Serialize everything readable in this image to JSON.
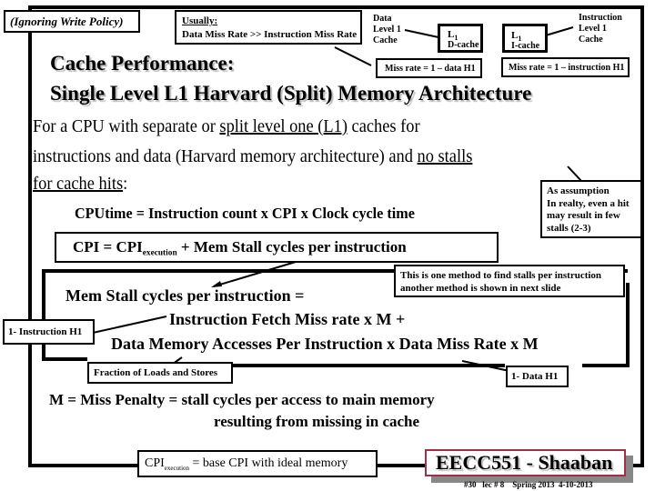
{
  "callouts": {
    "ignoring_write_policy": "(Ignoring Write Policy)",
    "usually_label": "Usually:",
    "usually_text": "Data Miss Rate >> Instruction Miss Rate",
    "data_l1_label": [
      "Data",
      "Level 1",
      "Cache"
    ],
    "d_cache_l": "L",
    "d_cache_sub": "1",
    "d_cache_name": "D-cache",
    "i_cache_l": "L",
    "i_cache_sub": "1",
    "i_cache_name": "I-cache",
    "instruction_l1_label": [
      "Instruction",
      "Level 1",
      "Cache"
    ],
    "data_miss_rate": "Miss rate = 1 – data H1",
    "instruction_miss_rate": "Miss rate = 1 – instruction H1",
    "assumption": [
      "As assumption",
      "In realty, even a hit",
      "may result in few",
      "stalls (2-3)"
    ],
    "method_note": [
      "This is one method to find stalls per instruction",
      "another method is shown in next slide"
    ],
    "instruction_h1": "1- Instruction H1",
    "fraction_loads_stores": "Fraction of Loads and Stores",
    "data_h1": "1- Data H1",
    "cpi_execution_main": "CPI",
    "cpi_execution_sub": "execution",
    "cpi_execution_def": "= base CPI with ideal memory"
  },
  "title": {
    "line1": "Cache Performance:",
    "line2": "Single Level L1 Harvard  (Split) Memory Architecture"
  },
  "body": {
    "p1_a": "For a CPU with separate or ",
    "p1_u": "split level  one (L1)",
    "p1_b": "  caches for",
    "p2_a": "instructions and data  (Harvard memory architecture)  and ",
    "p2_u": "no stalls",
    "p3_u": "for cache hits",
    "p3_b": ":",
    "cputime": "CPUtime  =  Instruction count x  CPI  x  Clock cycle time",
    "cpi_lhs": "CPI =    CPI",
    "cpi_sub": "execution",
    "cpi_rhs": " +  Mem Stall cycles per instruction",
    "mem_stall_1": "Mem Stall  cycles per instruction =",
    "mem_stall_2": "Instruction Fetch Miss rate x M  +",
    "mem_stall_3": "Data Memory Accesses Per Instruction x Data Miss Rate x M",
    "m_def_1": "M  =  Miss Penalty = stall cycles per access to main memory",
    "m_def_2": "resulting from missing in cache"
  },
  "footer": {
    "course": "EECC551 - Shaaban",
    "slide_info": "#30   lec # 8    Spring 2013  4-10-2013",
    "accent_color": "#a0304a"
  }
}
